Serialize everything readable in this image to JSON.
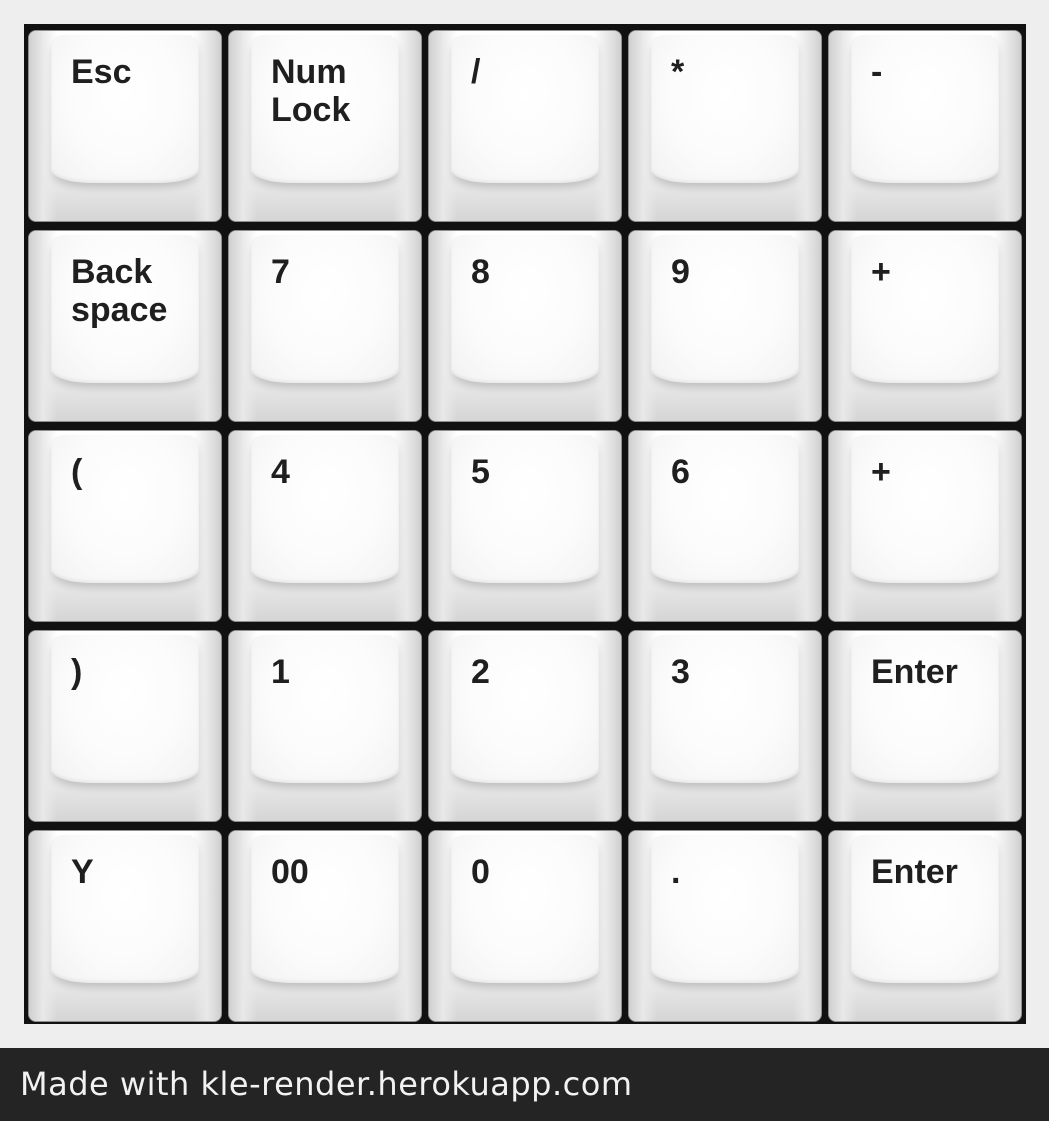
{
  "keyboard": {
    "rows": [
      [
        "Esc",
        "Num\nLock",
        "/",
        "*",
        "-"
      ],
      [
        "Back\nspace",
        "7",
        "8",
        "9",
        "+"
      ],
      [
        "(",
        "4",
        "5",
        "6",
        "+"
      ],
      [
        ")",
        "1",
        "2",
        "3",
        "Enter"
      ],
      [
        "Y",
        "00",
        "0",
        ".",
        "Enter"
      ]
    ]
  },
  "footer": {
    "text": "Made with kle-render.herokuapp.com"
  }
}
